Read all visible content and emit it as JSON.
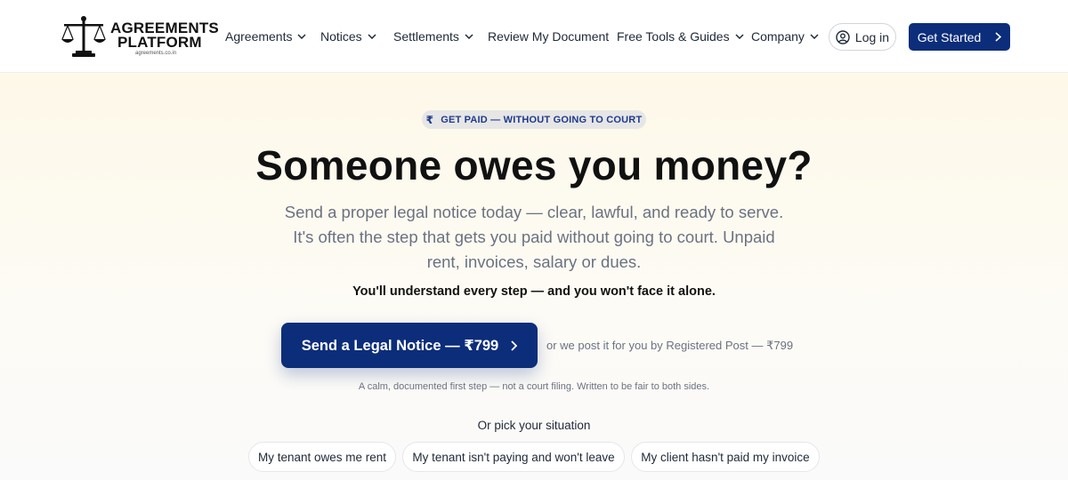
{
  "brand": {
    "line1": "AGREEMENTS",
    "line2": "PLATFORM",
    "domain": "agreements.co.in",
    "accent": "#0c2d7a"
  },
  "nav": {
    "items": [
      {
        "label": "Agreements",
        "dropdown": true
      },
      {
        "label": "Notices",
        "dropdown": true
      },
      {
        "label": "Settlements",
        "dropdown": true
      },
      {
        "label": "Review My Document",
        "dropdown": false
      },
      {
        "label": "Free Tools & Guides",
        "dropdown": true
      },
      {
        "label": "Company",
        "dropdown": true
      }
    ],
    "login_label": "Log in",
    "cta_label": "Get Started"
  },
  "hero": {
    "badge": "GET PAID — WITHOUT GOING TO COURT",
    "badge_icon": "rupee-icon",
    "title": "Someone owes you money?",
    "description": "Send a proper legal notice today — clear, lawful, and ready to serve. It's often the step that gets you paid without going to court. Unpaid rent, invoices, salary or dues.",
    "subline": "You'll understand every step — and you won't face it alone.",
    "primary_button": "Send a Legal Notice — ₹799",
    "alt_text": "or we post it for you by Registered Post — ₹799",
    "calm_note": "A calm, documented first step — not a court filing. Written to be fair to both sides.",
    "pick_label": "Or pick your situation",
    "situations": [
      "My tenant owes me rent",
      "My tenant isn't paying and won't leave",
      "My client hasn't paid my invoice"
    ]
  }
}
